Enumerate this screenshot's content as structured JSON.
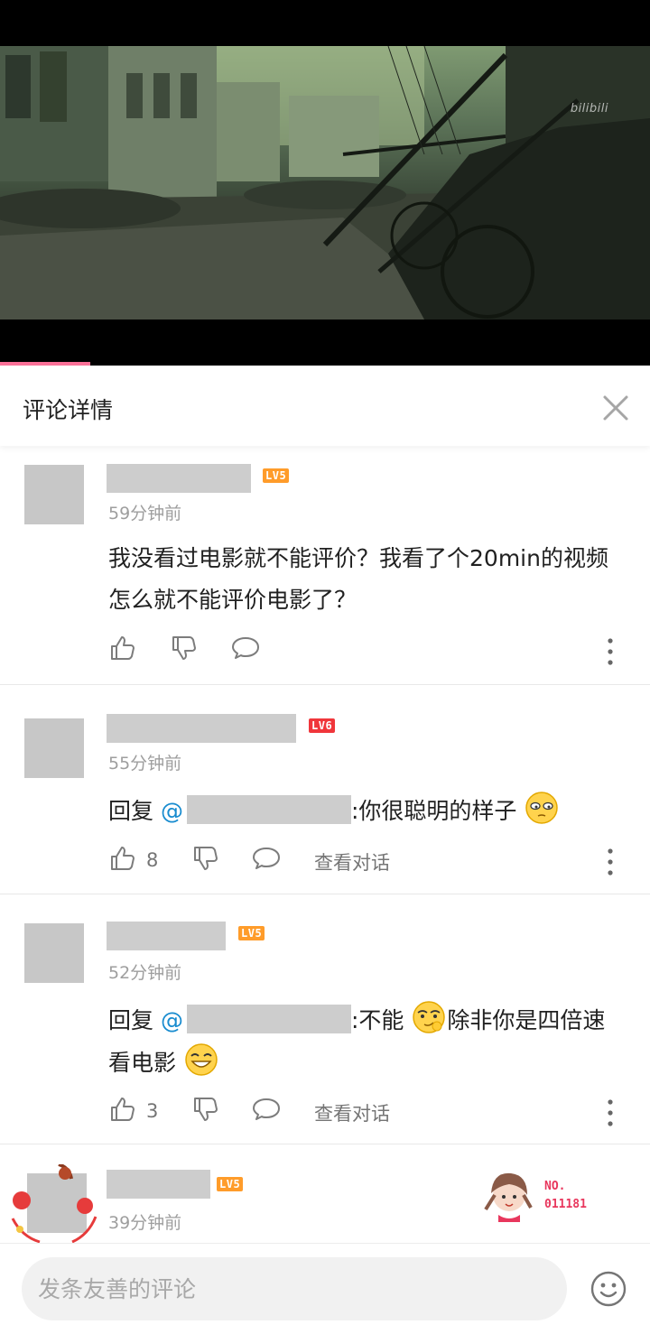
{
  "video": {
    "watermark": "bilibili",
    "progress_fraction": 0.139
  },
  "panel": {
    "title": "评论详情",
    "close_icon": "close-icon"
  },
  "comments": [
    {
      "level": "LV5",
      "time": "59分钟前",
      "text": "我没看过电影就不能评价？我看了个20min的视频怎么就不能评价电影了？",
      "likes": "",
      "show_view_conversation": false
    },
    {
      "level": "LV6",
      "time": "55分钟前",
      "reply_prefix": "回复",
      "mention_at": "@",
      "text_after": ":你很聪明的样子",
      "likes": "8",
      "view_conversation": "查看对话"
    },
    {
      "level": "LV5",
      "time": "52分钟前",
      "reply_prefix": "回复",
      "mention_at": "@",
      "text_part1": ":不能",
      "text_part2": "除非你是四倍速看电影",
      "likes": "3",
      "view_conversation": "查看对话"
    },
    {
      "level": "LV5",
      "time": "39分钟前",
      "fan_badge_label": "NO.",
      "fan_badge_number": "011181"
    }
  ],
  "input": {
    "placeholder": "发条友善的评论",
    "emoji_icon": "smiley-icon"
  },
  "colors": {
    "accent_pink": "#fb7299",
    "mention_blue": "#178bcf",
    "level5_orange": "#ff9c2a",
    "level6_red": "#f0363b"
  }
}
